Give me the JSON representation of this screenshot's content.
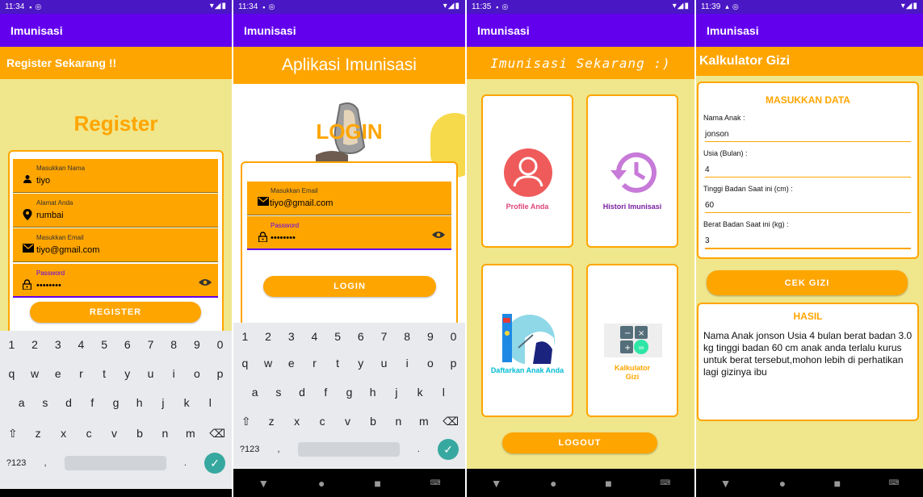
{
  "status_times": [
    "11:34",
    "11:34",
    "11:35",
    "11:39"
  ],
  "app_title": "Imunisasi",
  "register_screen": {
    "banner": "Register Sekarang !!",
    "title": "Register",
    "fields": [
      {
        "label": "Masukkan Nama",
        "value": "tiyo",
        "icon": "person-icon"
      },
      {
        "label": "Alamat Anda",
        "value": "rumbai",
        "icon": "location-pin-icon"
      },
      {
        "label": "Masukkan Email",
        "value": "tiyo@gmail.com",
        "icon": "email-icon"
      },
      {
        "label": "Password",
        "value": "••••••••",
        "icon": "lock-icon"
      }
    ],
    "button": "REGISTER"
  },
  "keyboard": {
    "numbers": [
      "1",
      "2",
      "3",
      "4",
      "5",
      "6",
      "7",
      "8",
      "9",
      "0"
    ],
    "row1": [
      "q",
      "w",
      "e",
      "r",
      "t",
      "y",
      "u",
      "i",
      "o",
      "p"
    ],
    "row2": [
      "a",
      "s",
      "d",
      "f",
      "g",
      "h",
      "j",
      "k",
      "l"
    ],
    "row3": [
      "z",
      "x",
      "c",
      "v",
      "b",
      "n",
      "m"
    ],
    "symbols_key": "?123",
    "comma": ",",
    "period": "."
  },
  "login_screen": {
    "banner": "Aplikasi Imunisasi",
    "title": "LOGIN",
    "email_label": "Masukkan Email",
    "email_value": "tiyo@gmail.com",
    "password_label": "Password",
    "password_value": "••••••••",
    "button": "LOGIN"
  },
  "menu_screen": {
    "banner": "Imunisasi Sekarang :)",
    "items": [
      {
        "label": "Profile Anda",
        "color": "#e0447c"
      },
      {
        "label": "Histori Imunisasi",
        "color": "#7b1fa2"
      },
      {
        "label": "Daftarkan Anak Anda",
        "color": "#00bcd4"
      },
      {
        "label": "Kalkulator Gizi",
        "color": "#ffa500"
      }
    ],
    "logout": "LOGOUT"
  },
  "gizi_screen": {
    "banner": "Kalkulator Gizi",
    "input_title": "MASUKKAN DATA",
    "inputs": [
      {
        "label": "Nama Anak :",
        "value": "jonson"
      },
      {
        "label": "Usia (Bulan) :",
        "value": "4"
      },
      {
        "label": "Tinggi Badan Saat ini (cm) :",
        "value": "60"
      },
      {
        "label": "Berat Badan Saat ini (kg) :",
        "value": "3"
      }
    ],
    "button": "CEK GIZI",
    "result_title": "HASIL",
    "result_text": "Nama Anak jonson Usia 4 bulan berat badan 3.0 kg tinggi badan 60 cm anak anda terlalu kurus untuk berat tersebut,mohon lebih di perhatikan lagi gizinya ibu"
  }
}
